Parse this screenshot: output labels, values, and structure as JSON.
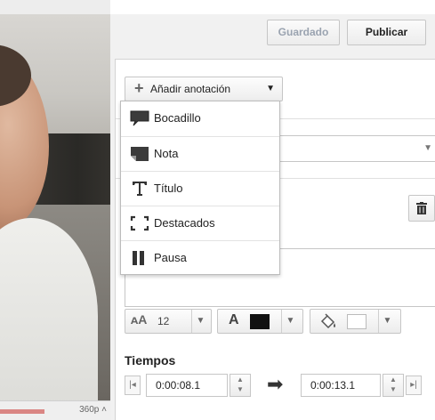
{
  "video": {
    "quality_label": "360p ˄"
  },
  "header": {
    "saved_label": "Guardado",
    "publish_label": "Publicar"
  },
  "annotation": {
    "add_label": "Añadir anotación",
    "add_caret": "▼",
    "menu_items": [
      {
        "label": "Bocadillo",
        "icon": "speech-bubble-icon"
      },
      {
        "label": "Nota",
        "icon": "note-icon"
      },
      {
        "label": "Título",
        "icon": "title-icon"
      },
      {
        "label": "Destacados",
        "icon": "spotlight-icon"
      },
      {
        "label": "Pausa",
        "icon": "pause-icon"
      }
    ]
  },
  "format": {
    "font_size": "12",
    "text_color": "#111111",
    "bg_color": "#ffffff"
  },
  "timing": {
    "heading": "Tiempos",
    "start": "0:00:08.1",
    "end": "0:00:13.1"
  }
}
